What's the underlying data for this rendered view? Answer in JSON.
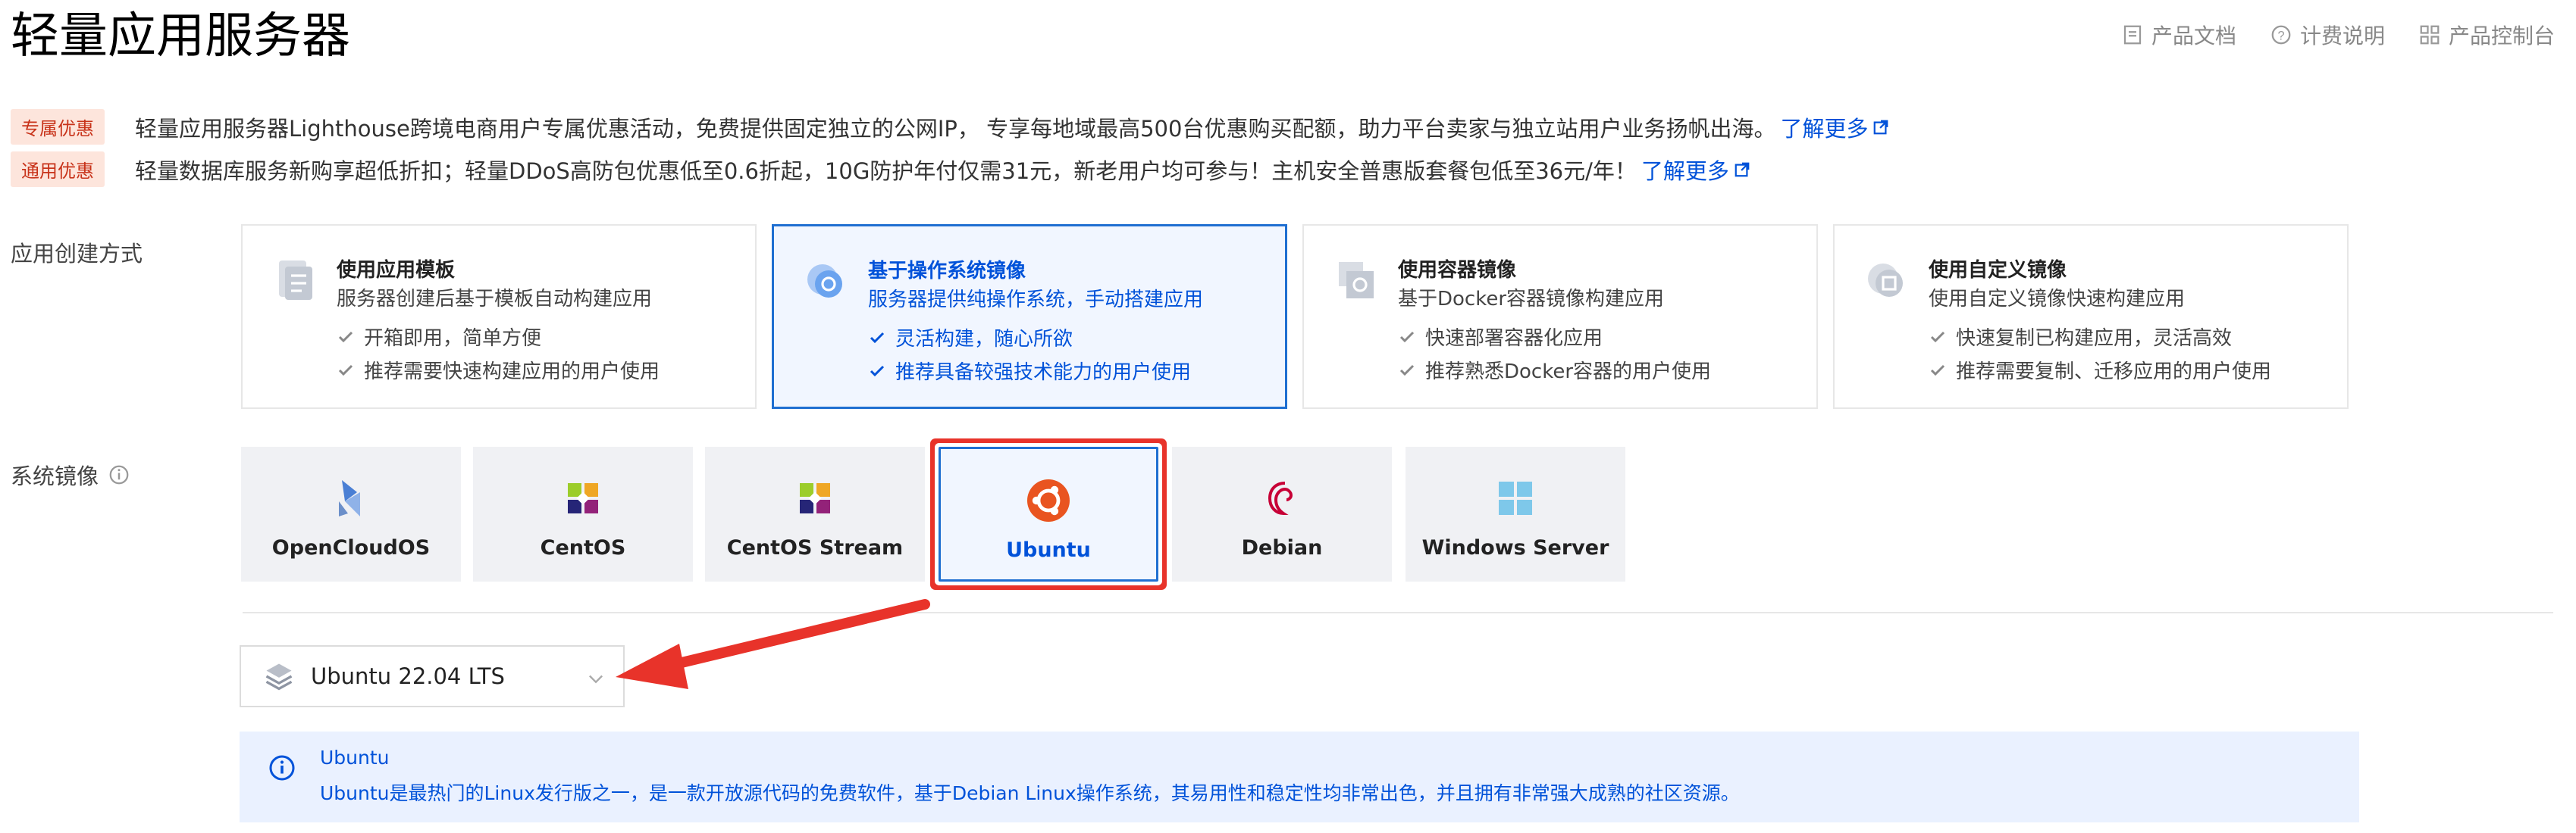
{
  "page": {
    "title": "轻量应用服务器"
  },
  "header": {
    "links": [
      {
        "label": "产品文档",
        "icon": "document-icon"
      },
      {
        "label": "计费说明",
        "icon": "question-circle-icon"
      },
      {
        "label": "产品控制台",
        "icon": "grid-icon"
      }
    ]
  },
  "promos": [
    {
      "badge": "专属优惠",
      "text": "轻量应用服务器Lighthouse跨境电商用户专属优惠活动，免费提供固定独立的公网IP， 专享每地域最高500台优惠购买配额，助力平台卖家与独立站用户业务扬帆出海。",
      "link": "了解更多"
    },
    {
      "badge": "通用优惠",
      "text": "轻量数据库服务新购享超低折扣；轻量DDoS高防包优惠低至0.6折起，10G防护年付仅需31元，新老用户均可参与！主机安全普惠版套餐包低至36元/年！",
      "link": "了解更多"
    }
  ],
  "creation_method": {
    "label": "应用创建方式",
    "cards": [
      {
        "title": "使用应用模板",
        "desc": "服务器创建后基于模板自动构建应用",
        "features": [
          "开箱即用，简单方便",
          "推荐需要快速构建应用的用户使用"
        ],
        "active": false
      },
      {
        "title": "基于操作系统镜像",
        "desc": "服务器提供纯操作系统，手动搭建应用",
        "features": [
          "灵活构建，随心所欲",
          "推荐具备较强技术能力的用户使用"
        ],
        "active": true
      },
      {
        "title": "使用容器镜像",
        "desc": "基于Docker容器镜像构建应用",
        "features": [
          "快速部署容器化应用",
          "推荐熟悉Docker容器的用户使用"
        ],
        "active": false
      },
      {
        "title": "使用自定义镜像",
        "desc": "使用自定义镜像快速构建应用",
        "features": [
          "快速复制已构建应用，灵活高效",
          "推荐需要复制、迁移应用的用户使用"
        ],
        "active": false
      }
    ]
  },
  "system_image": {
    "label": "系统镜像",
    "options": [
      {
        "name": "OpenCloudOS",
        "icon": "opencloudos-logo-icon"
      },
      {
        "name": "CentOS",
        "icon": "centos-logo-icon"
      },
      {
        "name": "CentOS Stream",
        "icon": "centos-stream-logo-icon"
      },
      {
        "name": "Ubuntu",
        "icon": "ubuntu-logo-icon",
        "selected": true
      },
      {
        "name": "Debian",
        "icon": "debian-logo-icon"
      },
      {
        "name": "Windows Server",
        "icon": "windows-logo-icon"
      }
    ],
    "version": "Ubuntu 22.04 LTS"
  },
  "info": {
    "title": "Ubuntu",
    "desc": "Ubuntu是最热门的Linux发行版之一，是一款开放源代码的免费软件，基于Debian Linux操作系统，其易用性和稳定性均非常出色，并且拥有非常强大成熟的社区资源。"
  },
  "colors": {
    "primary": "#0052d9",
    "highlight": "#e8332a",
    "badge_bg": "#fde5dc",
    "badge_text": "#c8331a"
  }
}
